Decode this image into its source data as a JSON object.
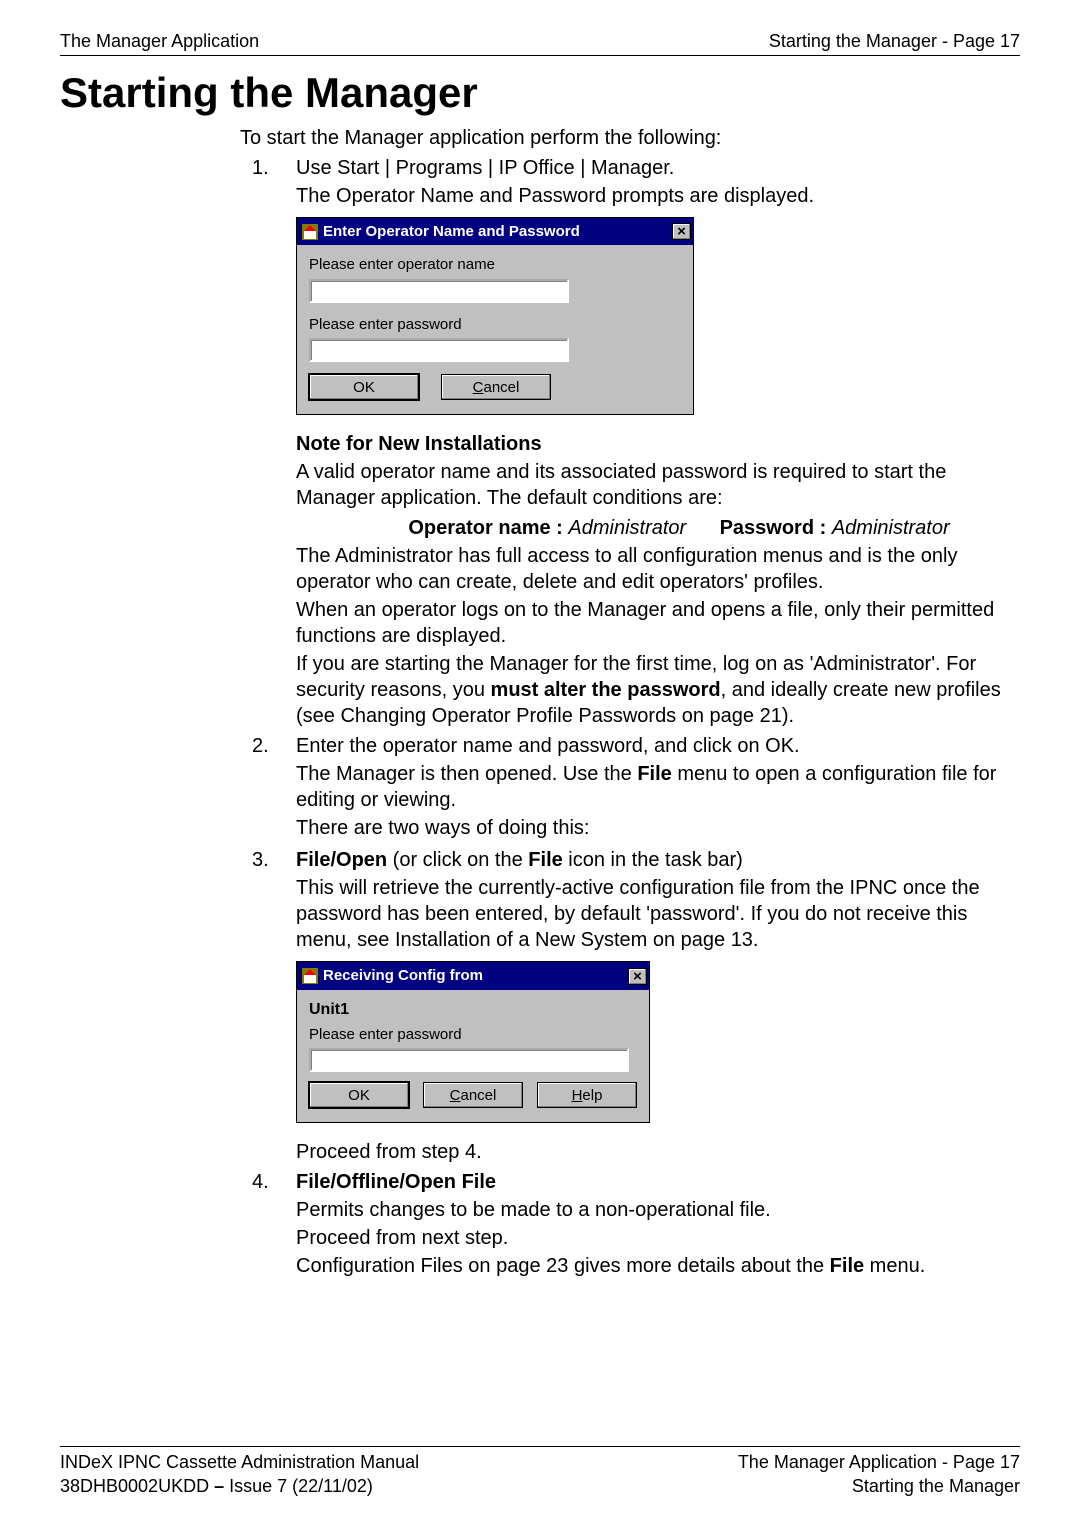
{
  "header": {
    "left": "The Manager Application",
    "right": "Starting the Manager - Page 17"
  },
  "h1": "Starting the Manager",
  "intro": "To start the Manager application perform the following:",
  "step1": {
    "num": "1.",
    "line1": "Use Start | Programs | IP Office | Manager.",
    "line2": "The Operator Name and Password prompts are displayed."
  },
  "dialog1": {
    "title": "Enter Operator Name and Password",
    "close": "×",
    "label1": "Please enter operator name",
    "label2": "Please enter password",
    "ok": "OK",
    "cancel": "Cancel",
    "cancel_u": "C"
  },
  "note": {
    "heading": "Note for New Installations",
    "p1": "A valid operator name and its associated password is required to start the Manager application. The default conditions are:",
    "cred_opname_label": "Operator name :",
    "cred_opname_val": "Administrator",
    "cred_pw_label": "Password :",
    "cred_pw_val": "Administrator",
    "p2": "The Administrator has full access to all configuration menus and is the only operator who can create, delete and edit operators' profiles.",
    "p3": "When an operator logs on to the Manager and opens a file, only their permitted functions are displayed.",
    "p4a": "If you are starting the Manager for the first time, log on as 'Administrator'. For security reasons, you ",
    "p4_bold": "must alter the password",
    "p4b": ", and ideally create new profiles (see Changing Operator Profile Passwords on page 21)."
  },
  "step2": {
    "num": "2.",
    "line1": "Enter the operator name and password, and click on OK.",
    "line2a": "The Manager is then opened. Use the ",
    "line2_bold": "File",
    "line2b": " menu to open a configuration file for editing or viewing.",
    "line3": "There are two ways of doing this:"
  },
  "step3": {
    "num": "3.",
    "bold1": "File/Open",
    "mid1": " (or click on the ",
    "bold2": "File",
    "mid2": " icon in the task bar)",
    "p1": "This will retrieve the currently-active configuration file from the IPNC once the password has been entered, by default 'password'. If you do not receive this menu, see Installation of a New System on page 13."
  },
  "dialog2": {
    "title": "Receiving Config from",
    "close": "×",
    "unit": "Unit1",
    "label": "Please enter password",
    "ok": "OK",
    "cancel": "Cancel",
    "cancel_u": "C",
    "help": "Help",
    "help_u": "H"
  },
  "proceed": "Proceed from step 4.",
  "step4": {
    "num": "4.",
    "bold": "File/Offline/Open File",
    "line1": "Permits changes to be made to a non-operational file.",
    "line2": "Proceed from next step.",
    "line3a": "Configuration Files on page 23 gives more details about the ",
    "line3_bold": "File",
    "line3b": " menu."
  },
  "footer": {
    "l1": "INDeX IPNC Cassette Administration Manual",
    "r1": "The Manager Application - Page 17",
    "l2": "38DHB0002UKDD – Issue 7 (22/11/02)",
    "r2": "Starting the Manager"
  },
  "dashchar": "–"
}
